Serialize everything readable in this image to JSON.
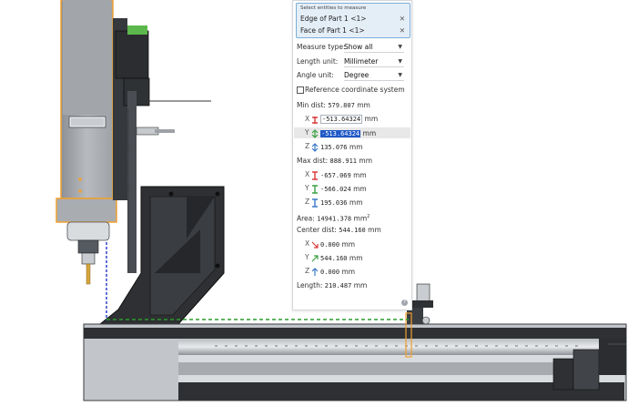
{
  "measure_panel": {
    "select_title": "Select entities to measure",
    "entities": [
      {
        "label": "Edge of Part 1 <1>"
      },
      {
        "label": "Face of Part 1 <1>"
      }
    ],
    "measure_type": {
      "label": "Measure type:",
      "value": "Show all"
    },
    "length_unit": {
      "label": "Length unit:",
      "value": "Millimeter"
    },
    "angle_unit": {
      "label": "Angle unit:",
      "value": "Degree"
    },
    "reference_coordinate_system": {
      "label": "Reference coordinate system",
      "checked": false
    },
    "min_dist": {
      "label": "Min dist:",
      "value": "579.807",
      "unit": "mm",
      "x": {
        "axis": "X",
        "value": "-513.64324",
        "unit": "mm"
      },
      "y": {
        "axis": "Y",
        "value": "-513.64324",
        "unit": "mm"
      },
      "z": {
        "axis": "Z",
        "value": "135.076",
        "unit": "mm"
      }
    },
    "max_dist": {
      "label": "Max dist:",
      "value": "888.911",
      "unit": "mm",
      "x": {
        "axis": "X",
        "value": "-657.069",
        "unit": "mm"
      },
      "y": {
        "axis": "Y",
        "value": "-566.024",
        "unit": "mm"
      },
      "z": {
        "axis": "Z",
        "value": "195.036",
        "unit": "mm"
      }
    },
    "area": {
      "label": "Area:",
      "value": "14941.378",
      "unit": "mm",
      "sup": "2"
    },
    "center_dist": {
      "label": "Center dist:",
      "value": "544.160",
      "unit": "mm",
      "x": {
        "axis": "X",
        "value": "0.000",
        "unit": "mm"
      },
      "y": {
        "axis": "Y",
        "value": "544.160",
        "unit": "mm"
      },
      "z": {
        "axis": "Z",
        "value": "0.000",
        "unit": "mm"
      }
    },
    "length": {
      "label": "Length:",
      "value": "210.487",
      "unit": "mm"
    },
    "remove_icon": "close-icon",
    "help_icon": "help-icon",
    "help_glyph": "?"
  },
  "colors": {
    "accent": "#1f58c7",
    "selection_bg": "#e4eef7",
    "selection_border": "#7aaed9",
    "highlight_orange": "#f0a030",
    "min_icon": "#d83a3a",
    "y_icon": "#3aa040",
    "z_icon": "#3a78c8",
    "dash_blue": "#1f35c8",
    "dash_green": "#2a9a2a",
    "part_dark": "#2e3033",
    "part_gray": "#9a9ea3"
  }
}
